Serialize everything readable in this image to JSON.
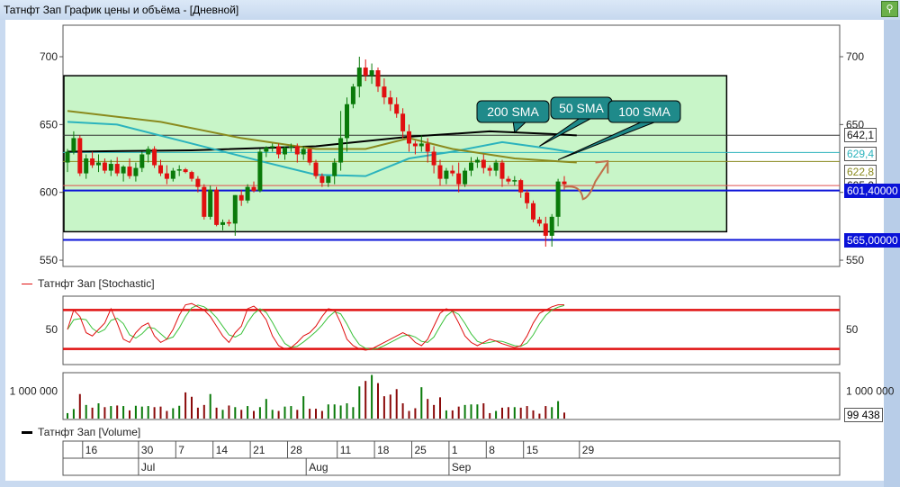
{
  "window": {
    "title": "Татнфт Зап График цены и объёма - [Дневной]",
    "pin_icon": "pin-icon"
  },
  "price_panel": {
    "y_ticks": [
      "700",
      "650",
      "600",
      "550"
    ],
    "y_tick_values": [
      700,
      650,
      600,
      550
    ],
    "ylim": [
      550,
      700
    ],
    "price_labels": {
      "sma200": "642,1",
      "sma50": "629,4",
      "sma100": "622,8",
      "red": "605,0",
      "last": "601,40000",
      "support": "565,00000"
    },
    "levels": {
      "sma200": 642.1,
      "sma50": 629.4,
      "sma100": 622.8,
      "red": 605.0,
      "last": 601.4,
      "support": 565.0
    },
    "callouts": {
      "sma200": "200 SMA",
      "sma50": "50 SMA",
      "sma100": "100 SMA"
    },
    "zone": {
      "top": 686,
      "bottom": 571,
      "end_index": 106
    },
    "colors": {
      "up": "#0a7a0a",
      "down": "#e01010",
      "zone": "#c8f5c8",
      "sma200": "#000000",
      "sma50": "#2bb3bd",
      "sma100": "#8a8a1e",
      "callout": "#1f8a8a"
    }
  },
  "chart_data": {
    "type": "candlestick",
    "candles": [
      [
        622,
        632,
        615,
        630
      ],
      [
        630,
        645,
        628,
        640
      ],
      [
        640,
        642,
        612,
        614
      ],
      [
        614,
        628,
        610,
        625
      ],
      [
        625,
        630,
        618,
        620
      ],
      [
        620,
        628,
        615,
        622
      ],
      [
        622,
        625,
        614,
        616
      ],
      [
        616,
        624,
        612,
        621
      ],
      [
        621,
        626,
        612,
        614
      ],
      [
        614,
        620,
        608,
        619
      ],
      [
        619,
        625,
        610,
        612
      ],
      [
        612,
        622,
        608,
        618
      ],
      [
        618,
        630,
        615,
        628
      ],
      [
        628,
        634,
        622,
        632
      ],
      [
        632,
        634,
        618,
        620
      ],
      [
        620,
        624,
        612,
        614
      ],
      [
        614,
        620,
        606,
        610
      ],
      [
        610,
        618,
        608,
        616
      ],
      [
        616,
        620,
        612,
        617
      ],
      [
        617,
        618,
        614,
        615
      ],
      [
        615,
        616,
        608,
        610
      ],
      [
        610,
        612,
        600,
        604
      ],
      [
        604,
        606,
        580,
        582
      ],
      [
        582,
        605,
        580,
        602
      ],
      [
        602,
        604,
        575,
        576
      ],
      [
        576,
        580,
        572,
        578
      ],
      [
        578,
        580,
        575,
        577
      ],
      [
        577,
        598,
        568,
        598
      ],
      [
        598,
        602,
        590,
        594
      ],
      [
        594,
        606,
        592,
        604
      ],
      [
        604,
        608,
        600,
        601
      ],
      [
        601,
        632,
        600,
        630
      ],
      [
        630,
        634,
        626,
        633
      ],
      [
        633,
        636,
        630,
        634
      ],
      [
        634,
        636,
        625,
        628
      ],
      [
        628,
        634,
        624,
        633
      ],
      [
        633,
        636,
        630,
        634
      ],
      [
        634,
        636,
        622,
        628
      ],
      [
        628,
        634,
        624,
        632
      ],
      [
        632,
        632,
        620,
        622
      ],
      [
        622,
        624,
        610,
        612
      ],
      [
        612,
        614,
        604,
        607
      ],
      [
        607,
        612,
        604,
        612
      ],
      [
        612,
        625,
        606,
        622
      ],
      [
        622,
        660,
        616,
        640
      ],
      [
        640,
        670,
        630,
        665
      ],
      [
        665,
        680,
        662,
        678
      ],
      [
        678,
        700,
        670,
        692
      ],
      [
        692,
        698,
        682,
        686
      ],
      [
        686,
        695,
        680,
        690
      ],
      [
        690,
        692,
        674,
        678
      ],
      [
        678,
        684,
        665,
        670
      ],
      [
        670,
        675,
        660,
        665
      ],
      [
        665,
        670,
        655,
        658
      ],
      [
        658,
        662,
        640,
        645
      ],
      [
        645,
        650,
        630,
        636
      ],
      [
        636,
        638,
        628,
        634
      ],
      [
        634,
        642,
        630,
        636
      ],
      [
        636,
        640,
        622,
        630
      ],
      [
        630,
        634,
        614,
        620
      ],
      [
        620,
        624,
        605,
        610
      ],
      [
        610,
        618,
        606,
        616
      ],
      [
        616,
        620,
        612,
        614
      ],
      [
        614,
        622,
        600,
        606
      ],
      [
        606,
        618,
        604,
        616
      ],
      [
        616,
        626,
        612,
        622
      ],
      [
        622,
        626,
        618,
        624
      ],
      [
        624,
        628,
        614,
        618
      ],
      [
        618,
        620,
        612,
        616
      ],
      [
        616,
        624,
        612,
        622
      ],
      [
        622,
        624,
        604,
        610
      ],
      [
        610,
        612,
        606,
        608
      ],
      [
        608,
        612,
        605,
        609
      ],
      [
        609,
        610,
        596,
        600
      ],
      [
        600,
        602,
        588,
        592
      ],
      [
        592,
        594,
        578,
        580
      ],
      [
        580,
        582,
        575,
        577
      ],
      [
        577,
        582,
        560,
        568
      ],
      [
        568,
        584,
        560,
        582
      ],
      [
        582,
        610,
        575,
        608
      ],
      [
        608,
        612,
        602,
        606
      ]
    ],
    "sma200": [
      [
        0,
        630
      ],
      [
        20,
        631
      ],
      [
        40,
        634
      ],
      [
        55,
        641
      ],
      [
        68,
        645
      ],
      [
        78,
        643
      ],
      [
        82,
        642
      ]
    ],
    "sma50": [
      [
        0,
        652
      ],
      [
        8,
        650
      ],
      [
        20,
        636
      ],
      [
        32,
        622
      ],
      [
        40,
        613
      ],
      [
        48,
        612
      ],
      [
        55,
        625
      ],
      [
        62,
        630
      ],
      [
        70,
        637
      ],
      [
        78,
        632
      ],
      [
        82,
        629
      ]
    ],
    "sma100": [
      [
        0,
        660
      ],
      [
        15,
        652
      ],
      [
        28,
        640
      ],
      [
        40,
        632
      ],
      [
        48,
        632
      ],
      [
        55,
        640
      ],
      [
        62,
        632
      ],
      [
        72,
        625
      ],
      [
        82,
        622
      ]
    ],
    "stochastic_k": [
      50,
      80,
      70,
      45,
      40,
      50,
      60,
      82,
      60,
      35,
      30,
      45,
      55,
      60,
      40,
      30,
      35,
      50,
      72,
      88,
      90,
      85,
      80,
      70,
      55,
      40,
      30,
      45,
      55,
      82,
      86,
      78,
      65,
      40,
      25,
      20,
      22,
      30,
      40,
      45,
      55,
      70,
      82,
      80,
      60,
      35,
      25,
      20,
      18,
      20,
      25,
      30,
      35,
      40,
      45,
      40,
      30,
      25,
      35,
      55,
      75,
      82,
      78,
      60,
      40,
      30,
      25,
      30,
      35,
      32,
      28,
      25,
      22,
      25,
      40,
      60,
      75,
      80,
      85,
      88,
      88
    ],
    "stochastic_levels": [
      80,
      20
    ],
    "stochastic_ylim": [
      0,
      100
    ],
    "volume": [
      200,
      350,
      900,
      500,
      400,
      560,
      420,
      460,
      480,
      460,
      300,
      470,
      440,
      460,
      420,
      440,
      280,
      380,
      470,
      960,
      800,
      400,
      500,
      900,
      400,
      320,
      480,
      420,
      320,
      460,
      280,
      420,
      720,
      320,
      280,
      440,
      460,
      320,
      820,
      360,
      360,
      280,
      520,
      520,
      480,
      560,
      420,
      1180,
      1380,
      1600,
      1300,
      820,
      880,
      1080,
      560,
      280,
      380,
      1150,
      720,
      500,
      780,
      300,
      300,
      440,
      500,
      520,
      520,
      560,
      200,
      280,
      400,
      420,
      420,
      400,
      460,
      300,
      180,
      460,
      420,
      640,
      220
    ],
    "volume_ticks": [
      "1 000 000"
    ],
    "volume_tick_value": 1000000,
    "volume_ylim": [
      0,
      1650000
    ],
    "last_volume": "99 438",
    "x_labels": [
      {
        "text": "16",
        "index": 2
      },
      {
        "text": "30",
        "index": 11
      },
      {
        "text": "7",
        "index": 17
      },
      {
        "text": "14",
        "index": 23
      },
      {
        "text": "21",
        "index": 29
      },
      {
        "text": "28",
        "index": 35
      },
      {
        "text": "11",
        "index": 43
      },
      {
        "text": "18",
        "index": 49
      },
      {
        "text": "25",
        "index": 55
      },
      {
        "text": "1",
        "index": 61
      },
      {
        "text": "8",
        "index": 67
      },
      {
        "text": "15",
        "index": 73
      },
      {
        "text": "29",
        "index": 82
      }
    ],
    "months": [
      {
        "text": "Jul",
        "index": 11
      },
      {
        "text": "Aug",
        "index": 38
      },
      {
        "text": "Sep",
        "index": 61
      }
    ]
  },
  "stoch_panel": {
    "legend": "Татнфт Зап [Stochastic]",
    "tick": "50"
  },
  "volume_panel": {
    "legend": "Татнфт Зап [Volume]"
  }
}
